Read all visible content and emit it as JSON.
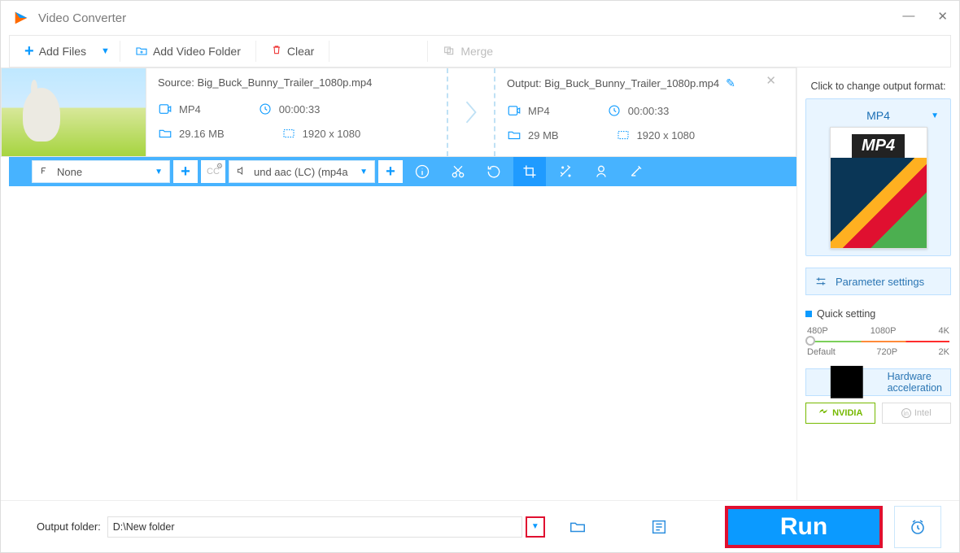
{
  "app": {
    "title": "Video Converter"
  },
  "toolbar": {
    "add_files": "Add Files",
    "add_folder": "Add Video Folder",
    "clear": "Clear",
    "merge": "Merge"
  },
  "file": {
    "source_label": "Source:",
    "source_name": "Big_Buck_Bunny_Trailer_1080p.mp4",
    "output_label": "Output:",
    "output_name": "Big_Buck_Bunny_Trailer_1080p.mp4",
    "src": {
      "format": "MP4",
      "duration": "00:00:33",
      "size": "29.16 MB",
      "resolution": "1920 x 1080"
    },
    "out": {
      "format": "MP4",
      "duration": "00:00:33",
      "size": "29 MB",
      "resolution": "1920 x 1080"
    }
  },
  "actionbar": {
    "subtitle_value": "None",
    "audio_value": "und aac (LC) (mp4a"
  },
  "right": {
    "change_label": "Click to change output format:",
    "format_name": "MP4",
    "format_badge": "MP4",
    "param_settings": "Parameter settings",
    "quick_setting": "Quick setting",
    "presets_top": [
      "480P",
      "1080P",
      "4K"
    ],
    "presets_bottom": [
      "Default",
      "720P",
      "2K"
    ],
    "hw_accel": "Hardware acceleration",
    "nvidia": "NVIDIA",
    "intel": "Intel"
  },
  "footer": {
    "label": "Output folder:",
    "value": "D:\\New folder",
    "run": "Run"
  }
}
